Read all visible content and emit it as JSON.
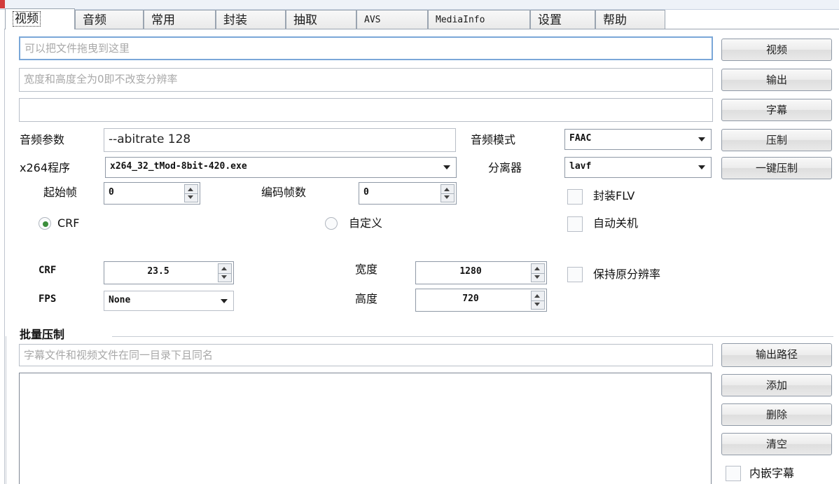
{
  "tabs": [
    {
      "label": "视频",
      "active": true
    },
    {
      "label": "音频"
    },
    {
      "label": "常用"
    },
    {
      "label": "封装"
    },
    {
      "label": "抽取"
    },
    {
      "label": "AVS"
    },
    {
      "label": "MediaInfo"
    },
    {
      "label": "设置"
    },
    {
      "label": "帮助"
    }
  ],
  "inputs": {
    "video_file": {
      "placeholder": "可以把文件拖曳到这里",
      "value": ""
    },
    "output_file": {
      "placeholder": "宽度和高度全为0即不改变分辨率",
      "value": ""
    },
    "subtitle_file": {
      "placeholder": "",
      "value": ""
    },
    "audio_params": {
      "label": "音频参数",
      "value": "--abitrate 128"
    },
    "batch_path": {
      "placeholder": "字幕文件和视频文件在同一目录下且同名",
      "value": ""
    }
  },
  "buttons": {
    "video": "视频",
    "output": "输出",
    "subtitle": "字幕",
    "encode": "压制",
    "one_click": "一键压制",
    "output_path": "输出路径",
    "add": "添加",
    "delete": "删除",
    "clear": "清空"
  },
  "labels": {
    "audio_mode": "音频模式",
    "x264_program": "x264程序",
    "splitter": "分离器",
    "start_frame": "起始帧",
    "encode_frames": "编码帧数",
    "crf_label": "CRF",
    "fps_label": "FPS",
    "width_label": "宽度",
    "height_label": "高度",
    "batch_group": "批量压制"
  },
  "selects": {
    "audio_mode": "FAAC",
    "x264_program": "x264_32_tMod-8bit-420.exe",
    "splitter": "lavf",
    "fps": "None"
  },
  "spinners": {
    "start_frame": "0",
    "encode_frames": "0",
    "crf": "23.5",
    "width": "1280",
    "height": "720"
  },
  "radios": {
    "crf": {
      "label": "CRF",
      "checked": true
    },
    "custom": {
      "label": "自定义",
      "checked": false
    }
  },
  "checkboxes": {
    "flv": {
      "label": "封装FLV",
      "checked": false
    },
    "shutdown": {
      "label": "自动关机",
      "checked": false
    },
    "keep_resolution": {
      "label": "保持原分辨率",
      "checked": false
    },
    "embed_subtitle": {
      "label": "内嵌字幕",
      "checked": false
    }
  },
  "colors": {
    "focus_border": "#7aa7d8",
    "radio_dot": "#3b8d3b",
    "app_icon": "#d23b3b"
  }
}
